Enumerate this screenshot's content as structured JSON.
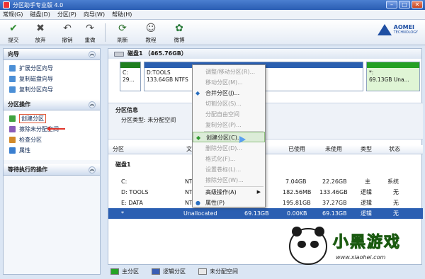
{
  "window": {
    "title": "分区助手专业版 4.0"
  },
  "menu": [
    "常规(G)",
    "磁盘(D)",
    "分区(P)",
    "向导(W)",
    "帮助(H)"
  ],
  "toolbar": {
    "buttons": [
      {
        "label": "提交",
        "icon": "checkmark-icon",
        "color": "#2e8b2e"
      },
      {
        "label": "放弃",
        "icon": "discard-icon",
        "color": "#4a4a4a"
      },
      {
        "label": "撤销",
        "icon": "undo-icon",
        "color": "#4a4a4a"
      },
      {
        "label": "重做",
        "icon": "redo-icon",
        "color": "#4a4a4a"
      },
      {
        "label": "刷新",
        "icon": "refresh-icon",
        "color": "#2a6f2a"
      },
      {
        "label": "教程",
        "icon": "tutorial-icon",
        "color": "#555"
      },
      {
        "label": "微博",
        "icon": "weibo-icon",
        "color": "#2a7a3a"
      }
    ],
    "logo_text": "AOMEI",
    "logo_sub": "TECHNOLOGY"
  },
  "sidebar": {
    "wizard": {
      "title": "向导",
      "items": [
        "扩展分区向导",
        "复制磁盘向导",
        "复制分区向导"
      ]
    },
    "operations": {
      "title": "分区操作",
      "items": [
        "创建分区",
        "擦除未分配空间",
        "检查分区",
        "属性"
      ]
    },
    "pending": {
      "title": "等待执行的操作"
    }
  },
  "disk": {
    "header": "磁盘1 （465.76GB）",
    "bars": [
      {
        "line1": "C:",
        "line2": "29...",
        "strip": "#1f7f1f",
        "bg": "#ffffff"
      },
      {
        "line1": "D:TOOLS",
        "line2": "133.64GB NTFS",
        "strip": "#2a5fb0",
        "bg": "#ffffff"
      },
      {
        "line1": "*:",
        "line2": "69.13GB Una...",
        "strip": "#24a024",
        "bg": "#dff5d5"
      }
    ]
  },
  "info": {
    "title": "分区信息",
    "type_label": "分区类型:",
    "type_value": "未分配空间"
  },
  "table": {
    "headers": [
      "分区",
      "文",
      "已使用",
      "未使用",
      "类型",
      "状态"
    ],
    "group": "磁盘1",
    "rows": [
      {
        "name": "C:",
        "fs": "NT",
        "capacity": "",
        "used": "7.04GB",
        "free": "22.26GB",
        "type": "主",
        "status": "系统"
      },
      {
        "name": "D: TOOLS",
        "fs": "NT",
        "capacity": "",
        "used": "182.56MB",
        "free": "133.46GB",
        "type": "逻辑",
        "status": "无"
      },
      {
        "name": "E: DATA",
        "fs": "NT",
        "capacity": "",
        "used": "195.81GB",
        "free": "37.27GB",
        "type": "逻辑",
        "status": "无"
      },
      {
        "name": "*",
        "fs": "Unallocated",
        "capacity": "69.13GB",
        "used": "0.00KB",
        "free": "69.13GB",
        "type": "逻辑",
        "status": "无"
      }
    ]
  },
  "context_menu": [
    {
      "label": "调整/移动分区(R)...",
      "enabled": false
    },
    {
      "label": "移动分区(M)...",
      "enabled": false
    },
    {
      "label": "合并分区(J)...",
      "enabled": true
    },
    {
      "label": "切割分区(S)...",
      "enabled": false
    },
    {
      "label": "分配自由空间",
      "enabled": false
    },
    {
      "label": "复制分区(P)...",
      "enabled": false
    },
    {
      "label": "创建分区(C)...",
      "enabled": true,
      "highlighted": true
    },
    {
      "label": "删除分区(D)...",
      "enabled": false
    },
    {
      "label": "格式化(F)...",
      "enabled": false
    },
    {
      "label": "设置卷标(L)...",
      "enabled": false
    },
    {
      "label": "擦除分区(W)...",
      "enabled": false
    },
    {
      "label": "高级操作(A)",
      "enabled": true,
      "submenu": true
    },
    {
      "label": "属性(P)",
      "enabled": true
    }
  ],
  "legend": [
    {
      "label": "主分区",
      "color": "#26a326"
    },
    {
      "label": "逻辑分区",
      "color": "#3a5fb5"
    },
    {
      "label": "未分配空间",
      "color": "#e8e8e8"
    }
  ],
  "watermark": {
    "text": "小黑游戏",
    "url": "www.xiaohei.com"
  }
}
